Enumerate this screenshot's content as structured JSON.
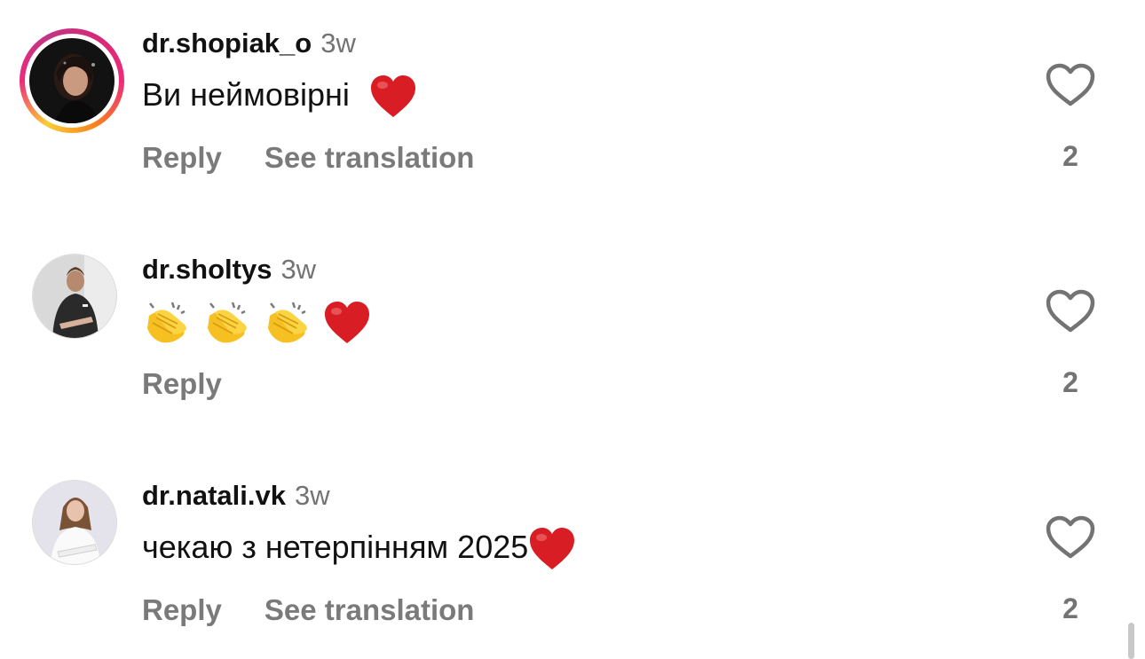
{
  "comments": [
    {
      "username": "dr.shopiak_o",
      "time": "3w",
      "text": "Ви неймовірні",
      "emoji": [
        "red-heart"
      ],
      "reply_label": "Reply",
      "translate_label": "See translation",
      "likes": "2",
      "has_story_ring": true
    },
    {
      "username": "dr.sholtys",
      "time": "3w",
      "text": "",
      "emoji": [
        "clapping-hands",
        "clapping-hands",
        "clapping-hands",
        "red-heart"
      ],
      "reply_label": "Reply",
      "likes": "2",
      "has_story_ring": false
    },
    {
      "username": "dr.natali.vk",
      "time": "3w",
      "text": "чекаю з нетерпінням 2025",
      "emoji": [
        "red-heart"
      ],
      "reply_label": "Reply",
      "translate_label": "See translation",
      "likes": "2",
      "has_story_ring": false
    }
  ],
  "icons": {
    "like": "heart-outline-icon"
  },
  "colors": {
    "text": "#111111",
    "secondary": "#737373",
    "heart": "#e0141e",
    "story_ring": [
      "#f9ce34",
      "#ee2a7b",
      "#c13584"
    ]
  }
}
